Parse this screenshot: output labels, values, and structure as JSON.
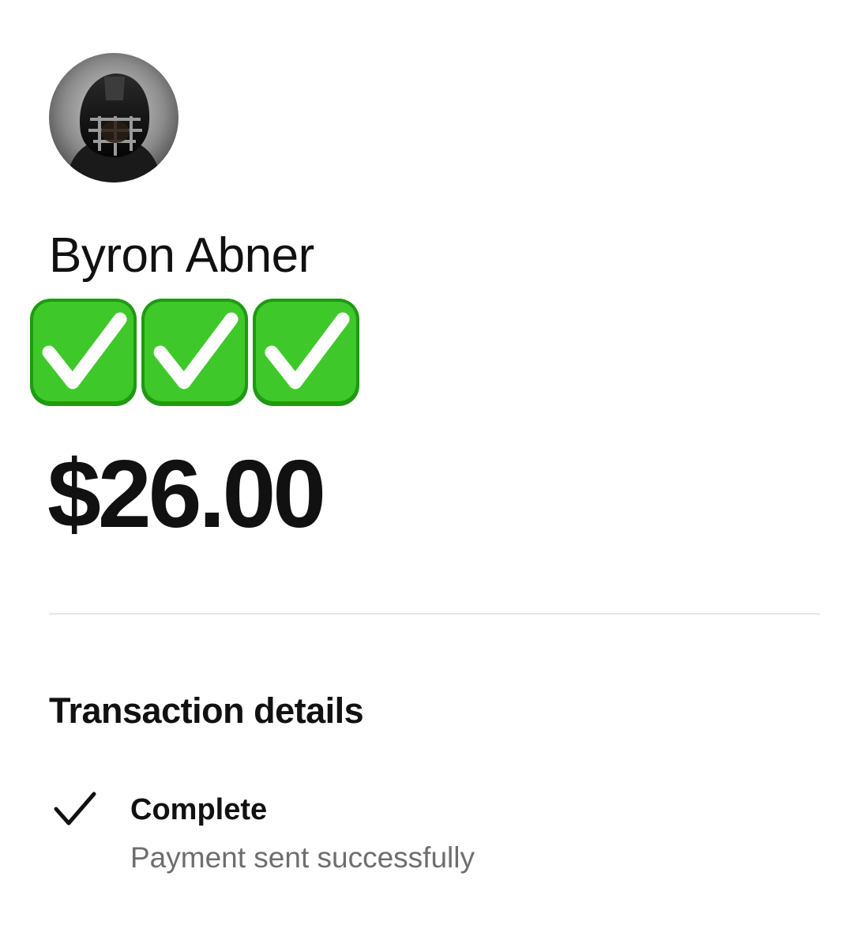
{
  "recipient": {
    "name": "Byron Abner",
    "avatar_icon": "profile-photo-football-helmet",
    "badges": [
      "check-mark-button-emoji",
      "check-mark-button-emoji",
      "check-mark-button-emoji"
    ],
    "badge_color": "#2fbf1c"
  },
  "payment": {
    "amount": "$26.00"
  },
  "details": {
    "title": "Transaction details",
    "status_icon": "checkmark-icon",
    "status_label": "Complete",
    "status_description": "Payment sent successfully"
  },
  "colors": {
    "text": "#111111",
    "secondary_text": "#6e6e6e",
    "divider": "#e6e6e6"
  }
}
